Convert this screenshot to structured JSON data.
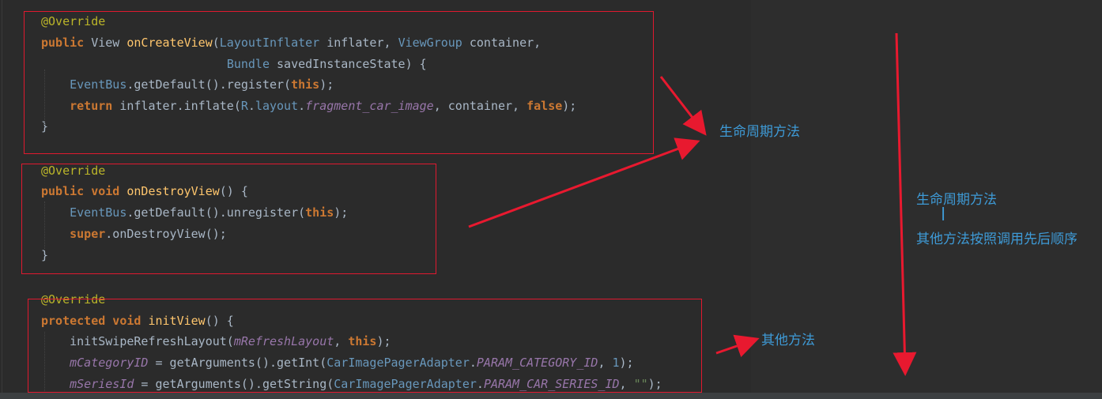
{
  "code_blocks": [
    {
      "lines": [
        [
          [
            "ann",
            "@Override"
          ]
        ],
        [
          [
            "kw",
            "public "
          ],
          [
            "cls",
            "View "
          ],
          [
            "mth",
            "onCreateView"
          ],
          [
            "p",
            "("
          ],
          [
            "typ",
            "LayoutInflater"
          ],
          [
            "p",
            " inflater, "
          ],
          [
            "typ",
            "ViewGroup"
          ],
          [
            "p",
            " container,"
          ]
        ],
        [
          [
            "p",
            "                          "
          ],
          [
            "typ",
            "Bundle"
          ],
          [
            "p",
            " savedInstanceState) {"
          ]
        ],
        [
          [
            "p",
            "    "
          ],
          [
            "typ",
            "EventBus"
          ],
          [
            "p",
            ".getDefault().register("
          ],
          [
            "thisk",
            "this"
          ],
          [
            "p",
            ");"
          ]
        ],
        [
          [
            "p",
            "    "
          ],
          [
            "kw",
            "return "
          ],
          [
            "p",
            "inflater.inflate("
          ],
          [
            "typ",
            "R"
          ],
          [
            "p",
            "."
          ],
          [
            "typ",
            "layout"
          ],
          [
            "p",
            "."
          ],
          [
            "fld",
            "fragment_car_image"
          ],
          [
            "p",
            ", container, "
          ],
          [
            "kw",
            "false"
          ],
          [
            "p",
            ");"
          ]
        ],
        [
          [
            "p",
            "}"
          ]
        ]
      ]
    },
    {
      "lines": [
        [
          [
            "ann",
            "@Override"
          ]
        ],
        [
          [
            "kw",
            "public void "
          ],
          [
            "mth",
            "onDestroyView"
          ],
          [
            "p",
            "() {"
          ]
        ],
        [
          [
            "p",
            "    "
          ],
          [
            "typ",
            "EventBus"
          ],
          [
            "p",
            ".getDefault().unregister("
          ],
          [
            "thisk",
            "this"
          ],
          [
            "p",
            ");"
          ]
        ],
        [
          [
            "p",
            "    "
          ],
          [
            "kw",
            "super"
          ],
          [
            "p",
            ".onDestroyView();"
          ]
        ],
        [
          [
            "p",
            "}"
          ]
        ]
      ]
    },
    {
      "lines": [
        [
          [
            "ann",
            "@Override"
          ]
        ],
        [
          [
            "kw",
            "protected void "
          ],
          [
            "mth",
            "initView"
          ],
          [
            "p",
            "() {"
          ]
        ],
        [
          [
            "p",
            "    initSwipeRefreshLayout("
          ],
          [
            "fld",
            "mRefreshLayout"
          ],
          [
            "p",
            ", "
          ],
          [
            "thisk",
            "this"
          ],
          [
            "p",
            ");"
          ]
        ],
        [
          [
            "p",
            "    "
          ],
          [
            "fld",
            "mCategoryID"
          ],
          [
            "p",
            " = getArguments().getInt("
          ],
          [
            "typ",
            "CarImagePagerAdapter"
          ],
          [
            "p",
            "."
          ],
          [
            "fld",
            "PARAM_CATEGORY_ID"
          ],
          [
            "p",
            ", "
          ],
          [
            "num",
            "1"
          ],
          [
            "p",
            ");"
          ]
        ],
        [
          [
            "p",
            "    "
          ],
          [
            "fld",
            "mSeriesId"
          ],
          [
            "p",
            " = getArguments().getString("
          ],
          [
            "typ",
            "CarImagePagerAdapter"
          ],
          [
            "p",
            "."
          ],
          [
            "fld",
            "PARAM_CAR_SERIES_ID"
          ],
          [
            "p",
            ", "
          ],
          [
            "str",
            "\"\""
          ],
          [
            "p",
            ");"
          ]
        ]
      ]
    }
  ],
  "annotations": {
    "lifecycle_label": "生命周期方法",
    "other_label": "其他方法",
    "order_title": "生命周期方法",
    "order_bar": "|",
    "order_detail": "其他方法按照调用先后顺序"
  },
  "colors": {
    "highlight_box": "#e0192f",
    "arrow": "#e8192f",
    "annotation_text": "#3e9ad6",
    "editor_bg": "#2b2b2b"
  }
}
